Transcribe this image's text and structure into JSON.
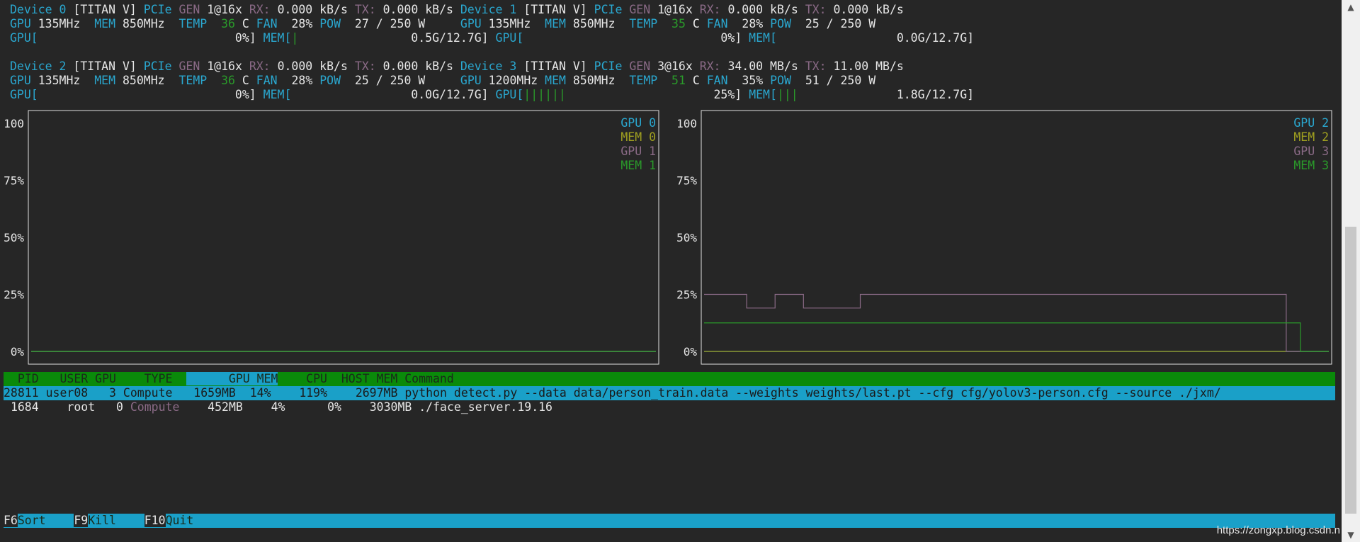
{
  "devices": {
    "d0": {
      "head": "Device 0",
      "model": "[TITAN V]",
      "pcie": "PCIe",
      "gen": "GEN",
      "gen_val": "1@16x",
      "rx_lab": "RX:",
      "rx": "0.000 kB/s",
      "tx_lab": "TX:",
      "tx": "0.000 kB/s",
      "gpu_lab": "GPU",
      "gpu_clock": "135MHz",
      "mem_lab": "MEM",
      "mem_clock": "850MHz",
      "temp_lab": "TEMP",
      "temp": "36",
      "temp_unit": "C",
      "fan_lab": "FAN",
      "fan": "28%",
      "pow_lab": "POW",
      "pow": "27 / 250 W",
      "gpu_bar_lab": "GPU[",
      "gpu_bar_fill": "",
      "gpu_pct": "0%]",
      "mem_bar_lab": "MEM[",
      "mem_bar_fill": "|",
      "mem_used": "0.5G/12.7G]"
    },
    "d1": {
      "head": "Device 1",
      "model": "[TITAN V]",
      "pcie": "PCIe",
      "gen": "GEN",
      "gen_val": "1@16x",
      "rx_lab": "RX:",
      "rx": "0.000 kB/s",
      "tx_lab": "TX:",
      "tx": "0.000 kB/s",
      "gpu_lab": "GPU",
      "gpu_clock": "135MHz",
      "mem_lab": "MEM",
      "mem_clock": "850MHz",
      "temp_lab": "TEMP",
      "temp": "35",
      "temp_unit": "C",
      "fan_lab": "FAN",
      "fan": "28%",
      "pow_lab": "POW",
      "pow": "25 / 250 W",
      "gpu_bar_lab": "GPU[",
      "gpu_bar_fill": "",
      "gpu_pct": "0%]",
      "mem_bar_lab": "MEM[",
      "mem_bar_fill": "",
      "mem_used": "0.0G/12.7G]"
    },
    "d2": {
      "head": "Device 2",
      "model": "[TITAN V]",
      "pcie": "PCIe",
      "gen": "GEN",
      "gen_val": "1@16x",
      "rx_lab": "RX:",
      "rx": "0.000 kB/s",
      "tx_lab": "TX:",
      "tx": "0.000 kB/s",
      "gpu_lab": "GPU",
      "gpu_clock": "135MHz",
      "mem_lab": "MEM",
      "mem_clock": "850MHz",
      "temp_lab": "TEMP",
      "temp": "36",
      "temp_unit": "C",
      "fan_lab": "FAN",
      "fan": "28%",
      "pow_lab": "POW",
      "pow": "25 / 250 W",
      "gpu_bar_lab": "GPU[",
      "gpu_bar_fill": "",
      "gpu_pct": "0%]",
      "mem_bar_lab": "MEM[",
      "mem_bar_fill": "",
      "mem_used": "0.0G/12.7G]"
    },
    "d3": {
      "head": "Device 3",
      "model": "[TITAN V]",
      "pcie": "PCIe",
      "gen": "GEN",
      "gen_val": "3@16x",
      "rx_lab": "RX:",
      "rx": "34.00 MB/s",
      "tx_lab": "TX:",
      "tx": "11.00 MB/s",
      "gpu_lab": "GPU",
      "gpu_clock": "1200MHz",
      "mem_lab": "MEM",
      "mem_clock": "850MHz",
      "temp_lab": "TEMP",
      "temp": "51",
      "temp_unit": "C",
      "fan_lab": "FAN",
      "fan": "35%",
      "pow_lab": "POW",
      "pow": "51 / 250 W",
      "gpu_bar_lab": "GPU[",
      "gpu_bar_fill": "||||||",
      "gpu_pct": "25%]",
      "mem_bar_lab": "MEM[",
      "mem_bar_fill": "|||",
      "mem_used": "1.8G/12.7G]"
    }
  },
  "chart_data": [
    {
      "type": "line",
      "ylim": [
        0,
        100
      ],
      "yticks": [
        "100",
        "75%",
        "50%",
        "25%",
        "0%"
      ],
      "series": [
        {
          "name": "GPU 0",
          "color": "#2aa7cf",
          "values": [
            0,
            0,
            0,
            0,
            0,
            0,
            0,
            0,
            0,
            0,
            0,
            0,
            0,
            0,
            0,
            0,
            0,
            0,
            0,
            0,
            0,
            0,
            0,
            0,
            0,
            0,
            0,
            0,
            0,
            0,
            0,
            0,
            0,
            0,
            0,
            0,
            0,
            0,
            0,
            0,
            0,
            0,
            0,
            0,
            0
          ]
        },
        {
          "name": "MEM 0",
          "color": "#a0a020",
          "values": [
            0,
            0,
            0,
            0,
            0,
            0,
            0,
            0,
            0,
            0,
            0,
            0,
            0,
            0,
            0,
            0,
            0,
            0,
            0,
            0,
            0,
            0,
            0,
            0,
            0,
            0,
            0,
            0,
            0,
            0,
            0,
            0,
            0,
            0,
            0,
            0,
            0,
            0,
            0,
            0,
            0,
            0,
            0,
            0,
            0
          ]
        },
        {
          "name": "GPU 1",
          "color": "#8a6a86",
          "values": [
            0,
            0,
            0,
            0,
            0,
            0,
            0,
            0,
            0,
            0,
            0,
            0,
            0,
            0,
            0,
            0,
            0,
            0,
            0,
            0,
            0,
            0,
            0,
            0,
            0,
            0,
            0,
            0,
            0,
            0,
            0,
            0,
            0,
            0,
            0,
            0,
            0,
            0,
            0,
            0,
            0,
            0,
            0,
            0,
            0
          ]
        },
        {
          "name": "MEM 1",
          "color": "#2a9a2a",
          "values": [
            0,
            0,
            0,
            0,
            0,
            0,
            0,
            0,
            0,
            0,
            0,
            0,
            0,
            0,
            0,
            0,
            0,
            0,
            0,
            0,
            0,
            0,
            0,
            0,
            0,
            0,
            0,
            0,
            0,
            0,
            0,
            0,
            0,
            0,
            0,
            0,
            0,
            0,
            0,
            0,
            0,
            0,
            0,
            0,
            0
          ]
        }
      ]
    },
    {
      "type": "line",
      "ylim": [
        0,
        100
      ],
      "yticks": [
        "100",
        "75%",
        "50%",
        "25%",
        "0%"
      ],
      "series": [
        {
          "name": "GPU 2",
          "color": "#2aa7cf",
          "values": [
            0,
            0,
            0,
            0,
            0,
            0,
            0,
            0,
            0,
            0,
            0,
            0,
            0,
            0,
            0,
            0,
            0,
            0,
            0,
            0,
            0,
            0,
            0,
            0,
            0,
            0,
            0,
            0,
            0,
            0,
            0,
            0,
            0,
            0,
            0,
            0,
            0,
            0,
            0,
            0,
            0,
            0,
            0,
            0,
            0
          ]
        },
        {
          "name": "MEM 2",
          "color": "#a0a020",
          "values": [
            0,
            0,
            0,
            0,
            0,
            0,
            0,
            0,
            0,
            0,
            0,
            0,
            0,
            0,
            0,
            0,
            0,
            0,
            0,
            0,
            0,
            0,
            0,
            0,
            0,
            0,
            0,
            0,
            0,
            0,
            0,
            0,
            0,
            0,
            0,
            0,
            0,
            0,
            0,
            0,
            0,
            0,
            0,
            0,
            0
          ]
        },
        {
          "name": "GPU 3",
          "color": "#8a6a86",
          "values": [
            25,
            25,
            25,
            19,
            19,
            25,
            25,
            19,
            19,
            19,
            19,
            25,
            25,
            25,
            25,
            25,
            25,
            25,
            25,
            25,
            25,
            25,
            25,
            25,
            25,
            25,
            25,
            25,
            25,
            25,
            25,
            25,
            25,
            25,
            25,
            25,
            25,
            25,
            25,
            25,
            25,
            0,
            0,
            0,
            0
          ]
        },
        {
          "name": "MEM 3",
          "color": "#2a9a2a",
          "values": [
            12.5,
            12.5,
            12.5,
            12.5,
            12.5,
            12.5,
            12.5,
            12.5,
            12.5,
            12.5,
            12.5,
            12.5,
            12.5,
            12.5,
            12.5,
            12.5,
            12.5,
            12.5,
            12.5,
            12.5,
            12.5,
            12.5,
            12.5,
            12.5,
            12.5,
            12.5,
            12.5,
            12.5,
            12.5,
            12.5,
            12.5,
            12.5,
            12.5,
            12.5,
            12.5,
            12.5,
            12.5,
            12.5,
            12.5,
            12.5,
            12.5,
            12.5,
            0,
            0,
            0
          ]
        }
      ]
    }
  ],
  "procs": {
    "header": {
      "pre": "  PID   USER GPU    TYPE  ",
      "sel": "      GPU MEM",
      "post": "    CPU  HOST MEM Command"
    },
    "rows": [
      {
        "pid": "28811",
        "user": "user08",
        "gpu": "3",
        "type": "Compute",
        "gpu_mem": "1659MB",
        "pct": "14%",
        "cpu": "119%",
        "host_mem": "2697MB",
        "command": "python detect.py --data data/person_train.data --weights weights/last.pt --cfg cfg/yolov3-person.cfg --source ./jxm/"
      },
      {
        "pid": "1684",
        "user": "root",
        "gpu": "0",
        "type": "Compute",
        "gpu_mem": "452MB",
        "pct": "4%",
        "cpu": "0%",
        "host_mem": "3030MB",
        "command": "./face_server.19.16"
      }
    ]
  },
  "footer": {
    "k1": "F6",
    "a1": "Sort",
    "k2": "F9",
    "a2": "Kill",
    "k3": "F10",
    "a3": "Quit"
  },
  "watermark": "https://zongxp.blog.csdn.n",
  "scroll": {
    "up": "▲",
    "down": "▼"
  }
}
